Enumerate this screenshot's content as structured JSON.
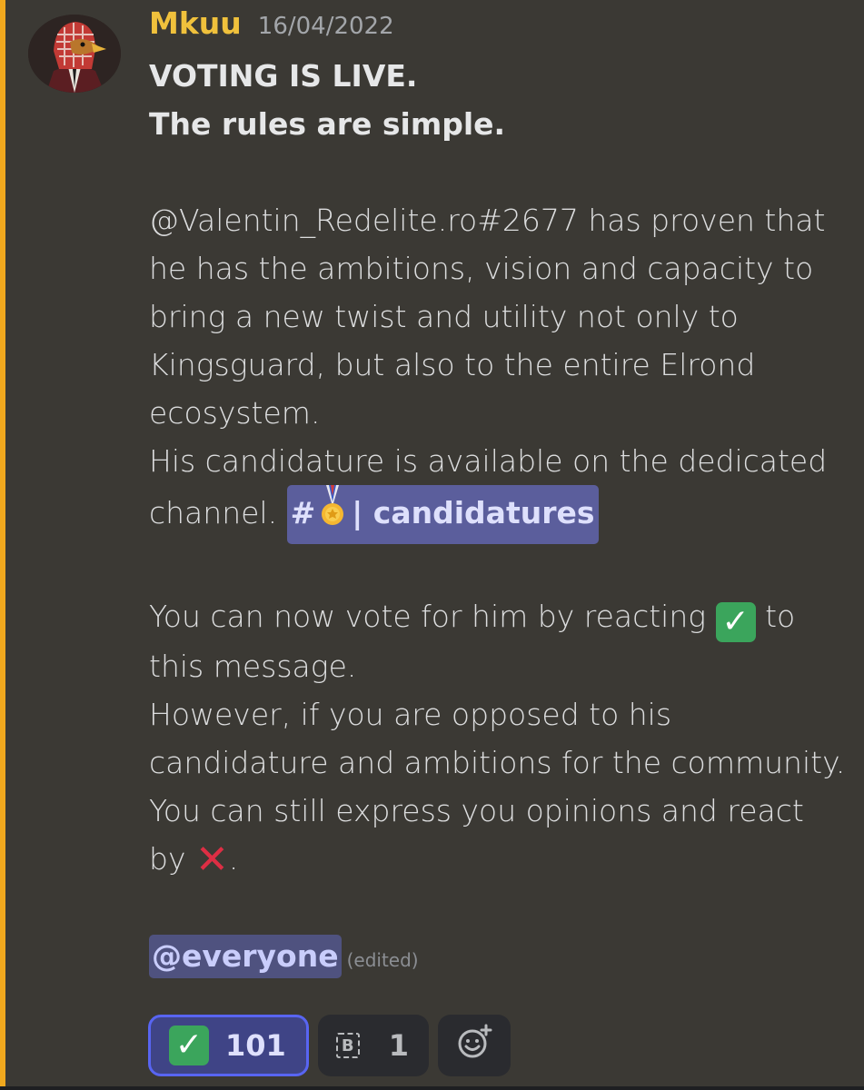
{
  "message": {
    "username": "Mkuu",
    "timestamp": "16/04/2022",
    "title_line1": "VOTING IS LIVE.",
    "title_line2": "The rules are simple.",
    "para1": "@Valentin_Redelite.ro#2677 has proven that he has the ambitions, vision and capacity to bring a new twist and utility not only to Kingsguard, but also to the entire Elrond ecosystem.",
    "para2_lead": "His candidature is available on the dedicated channel.",
    "channel_hash": "#",
    "channel_sep": "|",
    "channel_name": "candidatures",
    "vote_pre": "You can now vote for him by reacting",
    "vote_post": "to this message.",
    "oppose": "However, if you are opposed to his candidature and ambitions for the community. You can still express you opinions and react by",
    "oppose_end": ".",
    "everyone_mention": "@everyone",
    "edited_label": "(edited)"
  },
  "reactions": [
    {
      "emoji": "check-mark-button-emoji",
      "count": "101",
      "active": true
    },
    {
      "emoji": "b-button-emoji",
      "glyph": "B",
      "count": "1",
      "active": false
    }
  ],
  "colors": {
    "background": "#3b3934",
    "mention_bar": "#f0a81e",
    "username": "#f0c13c",
    "channel_pill": "#5b5e9c",
    "reaction_active_border": "#5865f2"
  }
}
